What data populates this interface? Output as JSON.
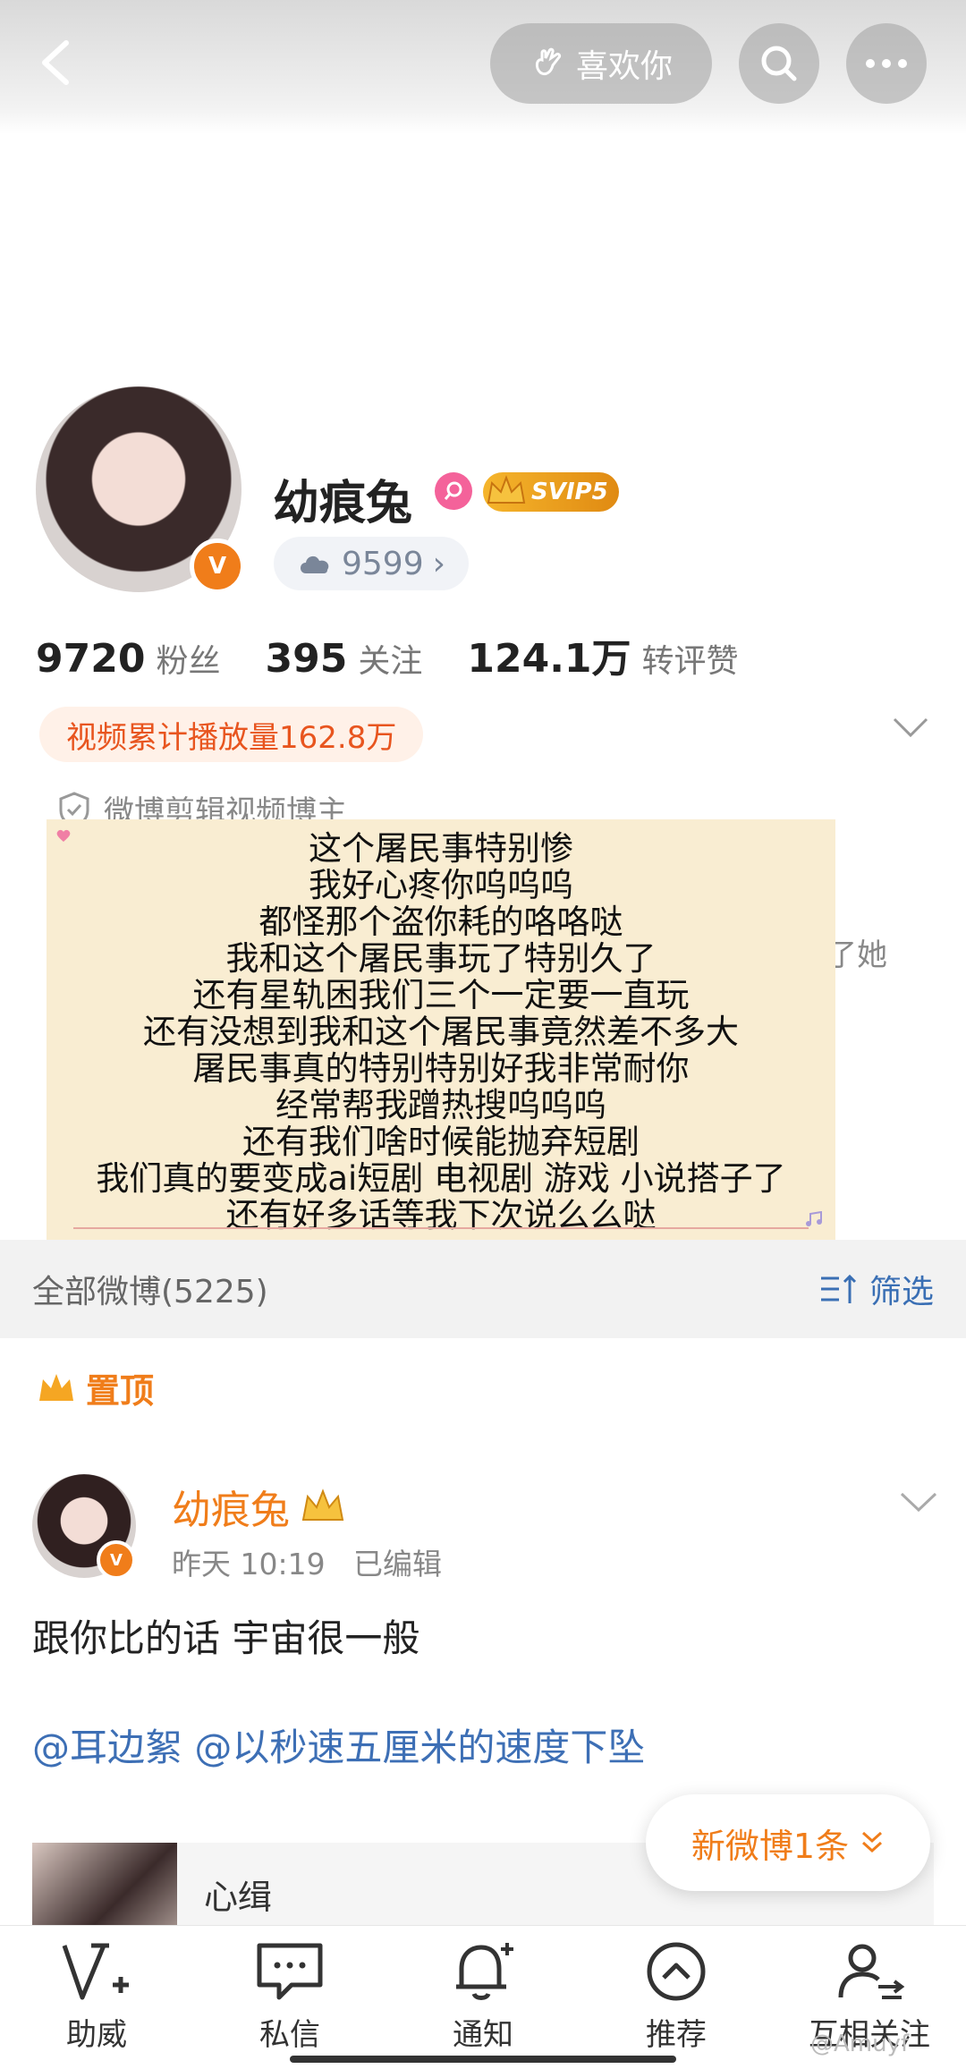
{
  "topbar": {
    "like_label": "喜欢你"
  },
  "profile": {
    "name": "幼痕兔",
    "vip_badge": "SVIP5",
    "verified_mark": "V",
    "level_value": "9599",
    "stats": [
      {
        "value": "9720",
        "label": "粉丝"
      },
      {
        "value": "395",
        "label": "关注"
      },
      {
        "value": "124.1万",
        "label": "转评赞"
      }
    ],
    "video_plays": "视频累计播放量162.8万",
    "certification": "微博剪辑视频博主",
    "partial_text": "了她"
  },
  "note": {
    "lines": [
      "这个屠民事特别惨",
      "我好心疼你呜呜呜",
      "都怪那个盗你耗的咯咯哒",
      "我和这个屠民事玩了特别久了",
      "还有星轨困我们三个一定要一直玩",
      "还有没想到我和这个屠民事竟然差不多大",
      "屠民事真的特别特别好我非常耐你",
      "经常帮我蹭热搜呜呜呜",
      "还有我们啥时候能抛弃短剧",
      "我们真的要变成ai短剧 电视剧 游戏 小说搭子了",
      "还有好多话等我下次说么么哒"
    ]
  },
  "section": {
    "title": "全部微博(5225)",
    "filter_label": "筛选"
  },
  "pinned_label": "置顶",
  "post": {
    "author": "幼痕兔",
    "meta": "昨天 10:19   已编辑",
    "text": "跟你比的话 宇宙很一般",
    "mentions": "@耳边絮 @以秒速五厘米的速度下坠",
    "quote_name": "心缉"
  },
  "new_post_label": "新微博1条",
  "bottom_nav": [
    {
      "label": "助威",
      "icon": "cheer-icon"
    },
    {
      "label": "私信",
      "icon": "message-icon"
    },
    {
      "label": "通知",
      "icon": "bell-icon"
    },
    {
      "label": "推荐",
      "icon": "recommend-icon"
    },
    {
      "label": "互相关注",
      "icon": "mutual-follow-icon"
    }
  ],
  "watermark": "@Amuyf",
  "colors": {
    "accent": "#f07d1a",
    "link": "#3d6fb5",
    "note_bg": "#f9edd2"
  }
}
